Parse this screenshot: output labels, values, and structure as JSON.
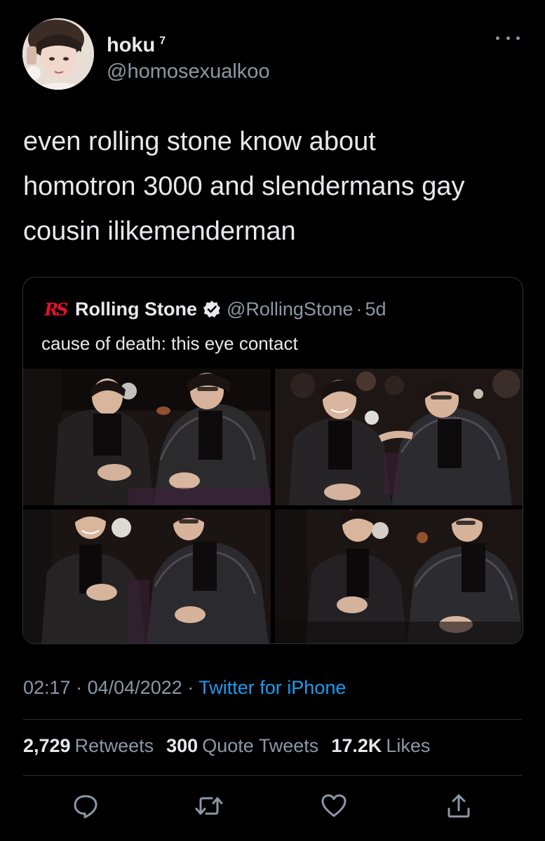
{
  "author": {
    "display_name": "hoku",
    "name_suffix": "7",
    "handle": "@homosexualkoo"
  },
  "tweet": {
    "text": "even rolling stone know about\nhomotron 3000 and slendermans gay\ncousin ilikemenderman"
  },
  "quoted": {
    "logo_text": "RS",
    "name": "Rolling Stone",
    "handle": "@RollingStone",
    "separator": "·",
    "age": "5d",
    "text": "cause of death: this eye contact"
  },
  "meta": {
    "time": "02:17",
    "sep1": "·",
    "date": "04/04/2022",
    "sep2": "·",
    "source": "Twitter for iPhone"
  },
  "stats": {
    "retweets_count": "2,729",
    "retweets_label": "Retweets",
    "quotes_count": "300",
    "quotes_label": "Quote Tweets",
    "likes_count": "17.2K",
    "likes_label": "Likes"
  },
  "icons": {
    "more": "more-horizontal-icon",
    "verified": "verified-badge-icon",
    "reply": "reply-icon",
    "retweet": "retweet-icon",
    "like": "heart-icon",
    "share": "share-icon"
  },
  "colors": {
    "background": "#000000",
    "text": "#e7e9ea",
    "secondary": "#8b98a5",
    "link": "#1d9bf0",
    "border": "#2f3336",
    "rs_red": "#e8102a"
  }
}
